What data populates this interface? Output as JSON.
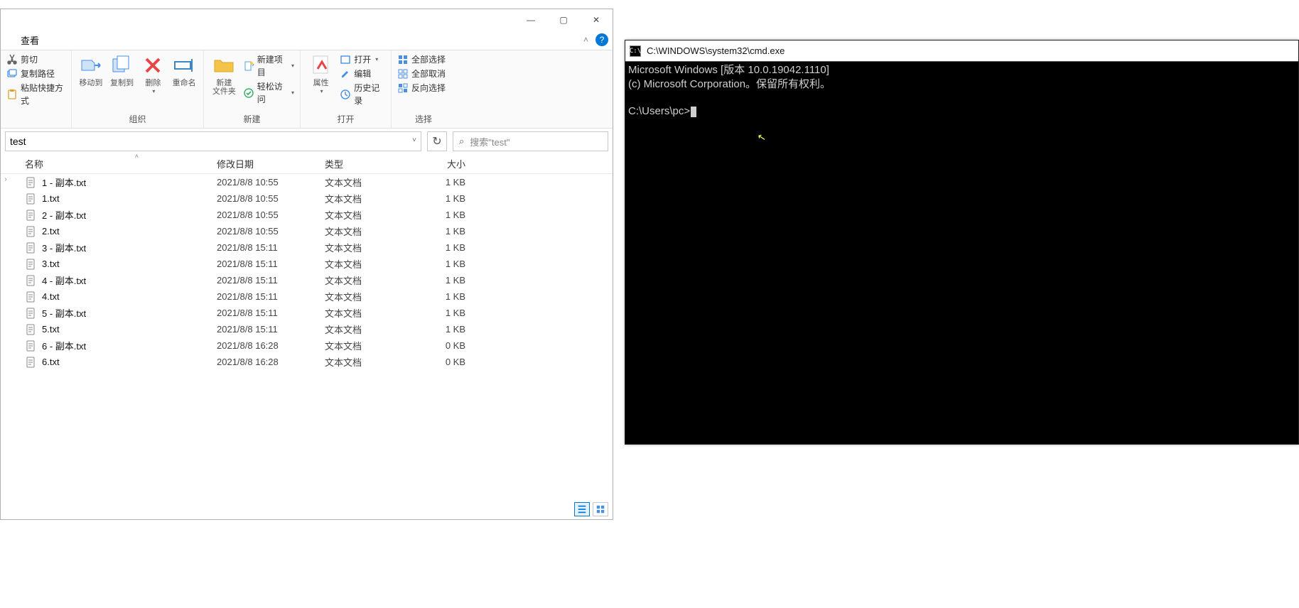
{
  "explorer": {
    "tab": {
      "view_label": "查看"
    },
    "window_controls": {
      "minimize": "—",
      "maximize": "▢",
      "close": "✕"
    },
    "ribbon": {
      "clipboard": {
        "cut": "剪切",
        "copy_path": "复制路径",
        "paste_shortcut": "粘贴快捷方式"
      },
      "organize": {
        "move_to": "移动到",
        "copy_to": "复制到",
        "delete": "删除",
        "rename": "重命名",
        "group_label": "组织"
      },
      "new": {
        "new_folder": "新建\n文件夹",
        "new_item": "新建项目",
        "easy_access": "轻松访问",
        "group_label": "新建"
      },
      "open": {
        "properties": "属性",
        "open": "打开",
        "edit": "编辑",
        "history": "历史记录",
        "group_label": "打开"
      },
      "select": {
        "select_all": "全部选择",
        "select_none": "全部取消",
        "invert": "反向选择",
        "group_label": "选择"
      }
    },
    "address": {
      "path": "test",
      "dropdown": "˅"
    },
    "refresh_glyph": "↻",
    "search": {
      "placeholder": "搜索\"test\"",
      "icon": "🔍"
    },
    "columns": {
      "name": "名称",
      "date": "修改日期",
      "type": "类型",
      "size": "大小"
    },
    "files": [
      {
        "name": "1 - 副本.txt",
        "date": "2021/8/8 10:55",
        "type": "文本文档",
        "size": "1 KB"
      },
      {
        "name": "1.txt",
        "date": "2021/8/8 10:55",
        "type": "文本文档",
        "size": "1 KB"
      },
      {
        "name": "2 - 副本.txt",
        "date": "2021/8/8 10:55",
        "type": "文本文档",
        "size": "1 KB"
      },
      {
        "name": "2.txt",
        "date": "2021/8/8 10:55",
        "type": "文本文档",
        "size": "1 KB"
      },
      {
        "name": "3 - 副本.txt",
        "date": "2021/8/8 15:11",
        "type": "文本文档",
        "size": "1 KB"
      },
      {
        "name": "3.txt",
        "date": "2021/8/8 15:11",
        "type": "文本文档",
        "size": "1 KB"
      },
      {
        "name": "4 - 副本.txt",
        "date": "2021/8/8 15:11",
        "type": "文本文档",
        "size": "1 KB"
      },
      {
        "name": "4.txt",
        "date": "2021/8/8 15:11",
        "type": "文本文档",
        "size": "1 KB"
      },
      {
        "name": "5 - 副本.txt",
        "date": "2021/8/8 15:11",
        "type": "文本文档",
        "size": "1 KB"
      },
      {
        "name": "5.txt",
        "date": "2021/8/8 15:11",
        "type": "文本文档",
        "size": "1 KB"
      },
      {
        "name": "6 - 副本.txt",
        "date": "2021/8/8 16:28",
        "type": "文本文档",
        "size": "0 KB"
      },
      {
        "name": "6.txt",
        "date": "2021/8/8 16:28",
        "type": "文本文档",
        "size": "0 KB"
      }
    ]
  },
  "cmd": {
    "title": "C:\\WINDOWS\\system32\\cmd.exe",
    "line1": "Microsoft Windows [版本 10.0.19042.1110]",
    "line2": "(c) Microsoft Corporation。保留所有权利。",
    "prompt": "C:\\Users\\pc>"
  }
}
